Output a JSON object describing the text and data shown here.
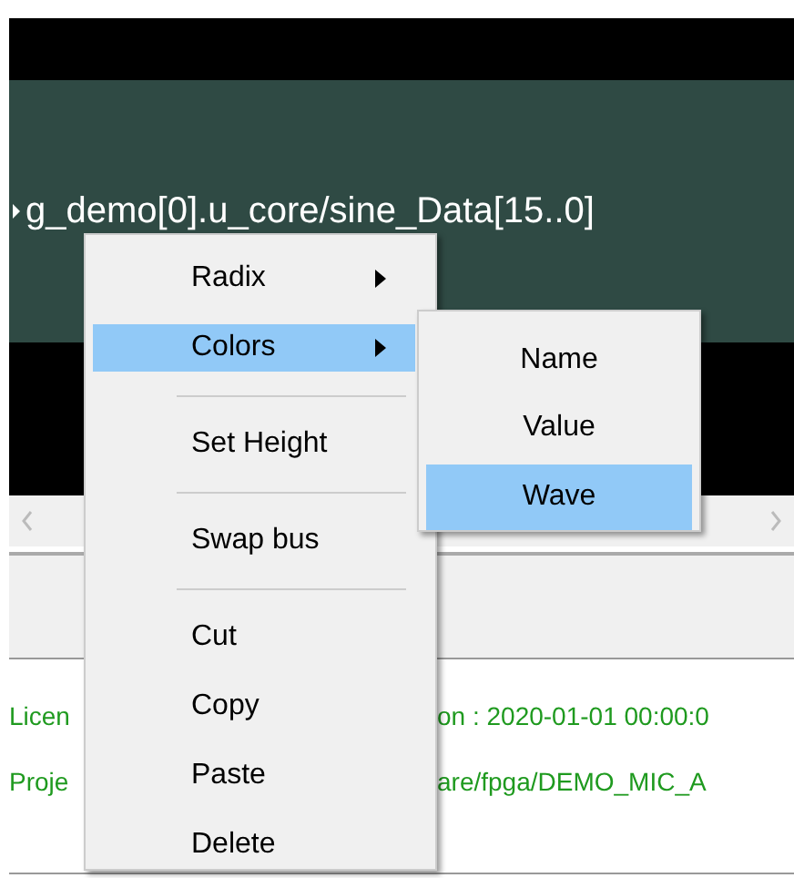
{
  "wave_view": {
    "signal": {
      "name": "g_demo[0].u_core/sine_Data[15..0]",
      "expanded": false
    }
  },
  "log": [
    {
      "left": "Licen",
      "right": "on : 2020-01-01 00:00:0"
    },
    {
      "left": "Proje",
      "right": "are/fpga/DEMO_MIC_A"
    }
  ],
  "context_menu": {
    "items": [
      {
        "kind": "submenu",
        "label": "Radix",
        "selected": false
      },
      {
        "kind": "submenu",
        "label": "Colors",
        "selected": true
      },
      {
        "kind": "separator"
      },
      {
        "kind": "command",
        "label": "Set Height",
        "selected": false
      },
      {
        "kind": "separator"
      },
      {
        "kind": "command",
        "label": "Swap bus",
        "selected": false
      },
      {
        "kind": "separator"
      },
      {
        "kind": "command",
        "label": "Cut",
        "selected": false
      },
      {
        "kind": "command",
        "label": "Copy",
        "selected": false
      },
      {
        "kind": "command",
        "label": "Paste",
        "selected": false
      },
      {
        "kind": "command",
        "label": "Delete",
        "selected": false
      }
    ]
  },
  "submenu": {
    "items": [
      {
        "label": "Name",
        "selected": false
      },
      {
        "label": "Value",
        "selected": false
      },
      {
        "label": "Wave",
        "selected": true
      }
    ]
  }
}
